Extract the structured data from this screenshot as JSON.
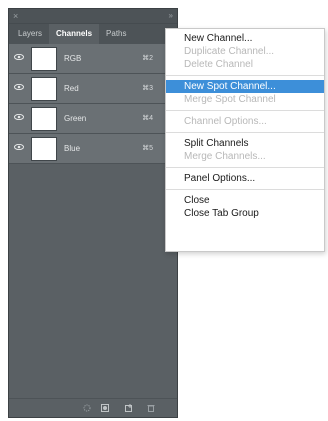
{
  "panel": {
    "close_glyph": "×",
    "collapse_glyph": "»",
    "menu_glyph": "≡",
    "tabs": [
      {
        "label": "Layers",
        "active": false
      },
      {
        "label": "Channels",
        "active": true
      },
      {
        "label": "Paths",
        "active": false
      }
    ],
    "channels": [
      {
        "name": "RGB",
        "shortcut": "⌘2",
        "visible": true
      },
      {
        "name": "Red",
        "shortcut": "⌘3",
        "visible": true
      },
      {
        "name": "Green",
        "shortcut": "⌘4",
        "visible": true
      },
      {
        "name": "Blue",
        "shortcut": "⌘5",
        "visible": true
      }
    ],
    "footer_icons": [
      "load-selection-icon",
      "save-selection-icon",
      "new-channel-icon",
      "trash-icon"
    ]
  },
  "menu": {
    "items": [
      {
        "label": "New Channel...",
        "enabled": true
      },
      {
        "label": "Duplicate Channel...",
        "enabled": false
      },
      {
        "label": "Delete Channel",
        "enabled": false
      },
      {
        "separator": true
      },
      {
        "label": "New Spot Channel...",
        "enabled": true,
        "highlighted": true
      },
      {
        "label": "Merge Spot Channel",
        "enabled": false
      },
      {
        "separator": true
      },
      {
        "label": "Channel Options...",
        "enabled": false
      },
      {
        "separator": true
      },
      {
        "label": "Split Channels",
        "enabled": true
      },
      {
        "label": "Merge Channels...",
        "enabled": false
      },
      {
        "separator": true
      },
      {
        "label": "Panel Options...",
        "enabled": true
      },
      {
        "separator": true
      },
      {
        "label": "Close",
        "enabled": true
      },
      {
        "label": "Close Tab Group",
        "enabled": true
      }
    ]
  },
  "colors": {
    "panel_bg": "#5a6064",
    "row_bg": "#6a7074",
    "highlight": "#3d8fd9",
    "disabled_text": "#b8b8b8"
  }
}
